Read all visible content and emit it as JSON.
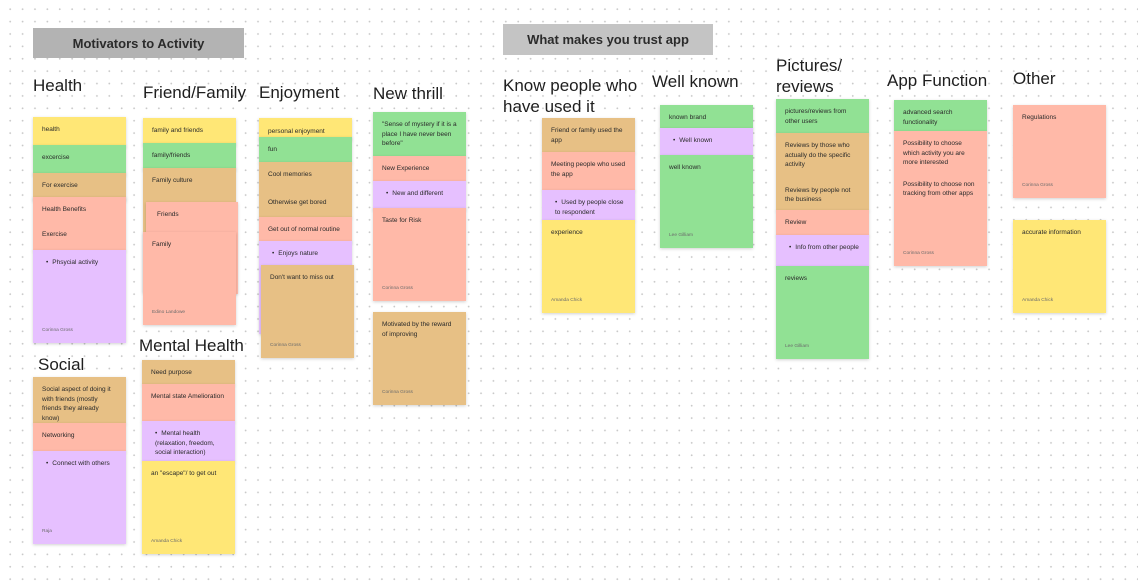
{
  "board": {
    "sections": [
      {
        "title": "Motivators to Activity"
      },
      {
        "title": "What makes you trust app"
      }
    ],
    "colors": {
      "yellow": "#ffe776",
      "green": "#91e194",
      "tan": "#e7c085",
      "salmon": "#ffb9a8",
      "violet": "#e6c0ff",
      "banner": "#b3b3b3",
      "background": "#ffffff"
    },
    "clusters": {
      "health": {
        "title": "Health",
        "notes": [
          "health",
          "excercise",
          "For exercise",
          "Health Benefits",
          "Exercise",
          "Phsycial activity"
        ],
        "author": "Corinna Gross"
      },
      "friend_family": {
        "title": "Friend/Family",
        "notes": [
          "family and friends",
          "family/friends",
          "Family culture",
          "Friends",
          "Family"
        ],
        "author": "Edino Landowe"
      },
      "enjoyment": {
        "title": "Enjoyment",
        "notes": [
          "personal enjoyment",
          "fun",
          "Cool memories",
          "Otherwise get bored",
          "Get out of normal routine",
          "Enjoys nature",
          "Don't want to miss out"
        ],
        "author": "Corinna Gross"
      },
      "new_thrill": {
        "title": "New thrill",
        "notes": [
          "\"Sense of mystery if it is a place I have never been before\"",
          "New Experience",
          "New and different",
          "Taste for Risk"
        ],
        "author": "Corinna Gross",
        "extra_note": "Motivated by the reward of improving",
        "extra_author": "Corinna Gross"
      },
      "social": {
        "title": "Social",
        "notes": [
          "Social aspect of doing it with friends (mostly friends they already know)",
          "Networking",
          "Connect with others"
        ],
        "author": "Raja"
      },
      "mental_health": {
        "title": "Mental Health",
        "notes": [
          "Need purpose",
          "Mental state Amelioration",
          "Mental health (relaxation, freedom, social interaction)",
          "an \"escape\"/ to get out"
        ],
        "author": "Amanda Chick"
      },
      "know_people": {
        "title": "Know people who\nhave used it",
        "notes": [
          "Friend or family used the app",
          "Meeting people who used the app",
          "Used by people close to respondent",
          "experience"
        ],
        "author": "Amanda Chick"
      },
      "well_known": {
        "title": "Well known",
        "notes": [
          "known brand",
          "Well known",
          "well known"
        ],
        "author": "Lee Gilliam"
      },
      "pictures_reviews": {
        "title": "Pictures/\nreviews",
        "notes": [
          "pictures/reviews from other users",
          "Reviews by those who actually do the specific activity",
          "Reviews by people not the business",
          "Review",
          "Info from other people",
          "reviews"
        ],
        "author": "Lee Gilliam"
      },
      "app_function": {
        "title": "App  Function",
        "notes": [
          "advanced search functionality",
          "Possibility to choose which activity you are more interested",
          "Possibility to choose non tracking from other apps"
        ],
        "author": "Corinna Gross"
      },
      "other": {
        "title": "Other",
        "notes": [
          "Regulations",
          "accurate information"
        ],
        "authors": [
          "Corinna Gross",
          "Amanda Chick"
        ]
      }
    }
  }
}
